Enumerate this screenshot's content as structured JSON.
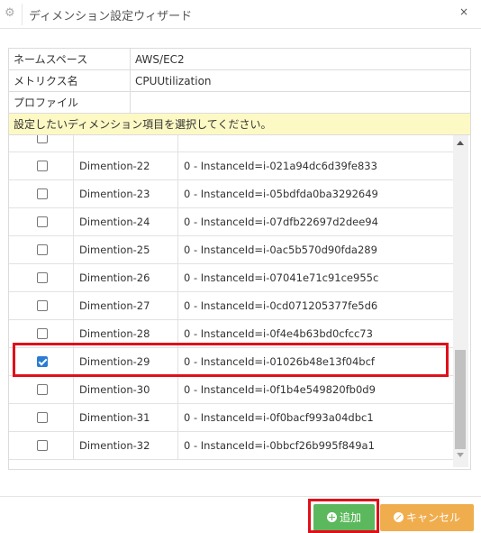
{
  "dialog": {
    "title": "ディメンション設定ウィザード",
    "close_label": "×"
  },
  "info": {
    "namespace_label": "ネームスペース",
    "namespace_value": "AWS/EC2",
    "metric_label": "メトリクス名",
    "metric_value": "CPUUtilization",
    "profile_label": "プロファイル",
    "profile_value": "",
    "message": "設定したいディメンション項目を選択してください。"
  },
  "rows": [
    {
      "name": "",
      "value": "",
      "checked": false
    },
    {
      "name": "Dimention-22",
      "value": "0 - InstanceId=i-021a94dc6d39fe833",
      "checked": false
    },
    {
      "name": "Dimention-23",
      "value": "0 - InstanceId=i-05bdfda0ba3292649",
      "checked": false
    },
    {
      "name": "Dimention-24",
      "value": "0 - InstanceId=i-07dfb22697d2dee94",
      "checked": false
    },
    {
      "name": "Dimention-25",
      "value": "0 - InstanceId=i-0ac5b570d90fda289",
      "checked": false
    },
    {
      "name": "Dimention-26",
      "value": "0 - InstanceId=i-07041e71c91ce955c",
      "checked": false
    },
    {
      "name": "Dimention-27",
      "value": "0 - InstanceId=i-0cd071205377fe5d6",
      "checked": false
    },
    {
      "name": "Dimention-28",
      "value": "0 - InstanceId=i-0f4e4b63bd0cfcc73",
      "checked": false
    },
    {
      "name": "Dimention-29",
      "value": "0 - InstanceId=i-01026b48e13f04bcf",
      "checked": true
    },
    {
      "name": "Dimention-30",
      "value": "0 - InstanceId=i-0f1b4e549820fb0d9",
      "checked": false
    },
    {
      "name": "Dimention-31",
      "value": "0 - InstanceId=i-0f0bacf993a04dbc1",
      "checked": false
    },
    {
      "name": "Dimention-32",
      "value": "0 - InstanceId=i-0bbcf26b995f849a1",
      "checked": false
    }
  ],
  "footer": {
    "add_label": "追加",
    "cancel_label": "キャンセル"
  },
  "colors": {
    "add": "#5cb85c",
    "cancel": "#f0ad4e",
    "highlight": "#e0101a",
    "message_bg": "#fdf9c5"
  }
}
